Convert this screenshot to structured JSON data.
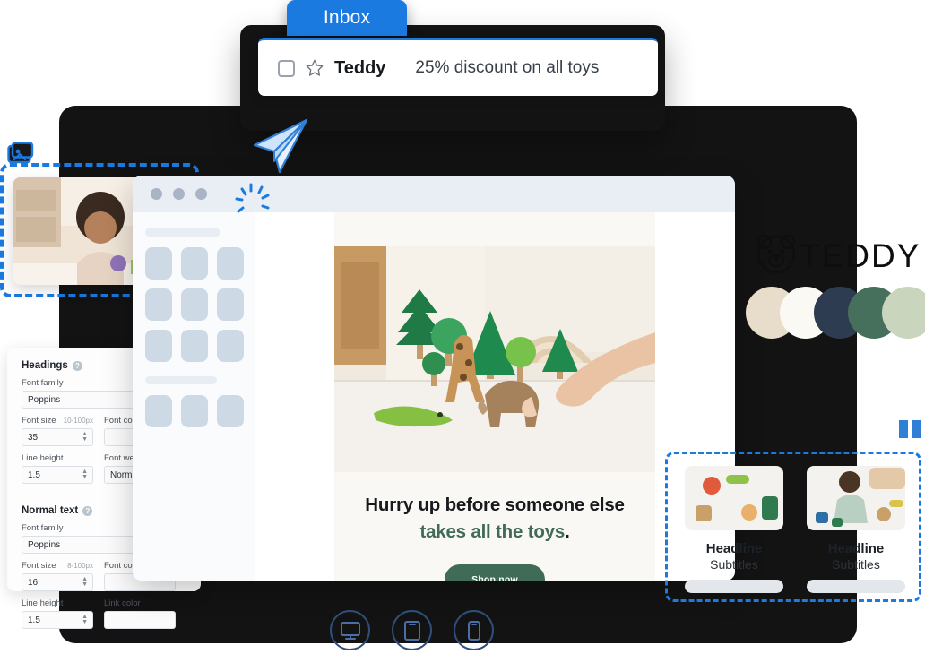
{
  "inbox": {
    "tab_label": "Inbox",
    "mail": {
      "sender": "Teddy",
      "subject": "25% discount on all toys",
      "checkbox_icon": "checkbox-icon",
      "star_icon": "star-icon"
    }
  },
  "send": {
    "plane_icon": "paper-plane-icon"
  },
  "photo_card": {
    "image_icon": "image-gallery-icon",
    "alt": "child playing with wooden toys"
  },
  "typography": {
    "sections": [
      {
        "title": "Headings",
        "help_icon": "help-icon",
        "font_family_label": "Font family",
        "font_family_value": "Poppins",
        "font_size_label": "Font size",
        "font_size_hint": "10-100px",
        "font_size_value": "35",
        "font_color_label": "Font color",
        "font_color_value": "",
        "line_height_label": "Line height",
        "line_height_value": "1.5",
        "extra_label": "Font weight",
        "extra_value": "Normal"
      },
      {
        "title": "Normal text",
        "help_icon": "help-icon",
        "font_family_label": "Font family",
        "font_family_value": "Poppins",
        "font_size_label": "Font size",
        "font_size_hint": "8-100px",
        "font_size_value": "16",
        "font_color_label": "Font color",
        "font_color_value": "",
        "line_height_label": "Line height",
        "line_height_value": "1.5",
        "extra_label": "Link color",
        "extra_value": ""
      }
    ]
  },
  "builder": {
    "window_dots": "window-controls",
    "loading_icon": "loading-spinner-icon",
    "email": {
      "hero_alt": "wooden animal and tree toys on a table",
      "headline_part1": "Hurry up before someone else ",
      "headline_accent": "takes all the toys",
      "headline_end": ".",
      "cta_label": "Shop now"
    }
  },
  "brand": {
    "logo_text": "TEDDY",
    "logo_icon": "teddy-bear-icon",
    "palette": [
      {
        "name": "beige",
        "hex": "#e8dccb"
      },
      {
        "name": "off-white",
        "hex": "#fbf9f4"
      },
      {
        "name": "navy",
        "hex": "#2e3c51"
      },
      {
        "name": "green",
        "hex": "#47705c"
      },
      {
        "name": "sage",
        "hex": "#c9d6bd"
      }
    ]
  },
  "cards": {
    "layout_icon": "two-column-layout-icon",
    "items": [
      {
        "headline": "Headline",
        "subtitle": "Subtitles",
        "image_alt": "toys on floor"
      },
      {
        "headline": "Headline",
        "subtitle": "Subtitles",
        "image_alt": "child sitting with toys"
      }
    ]
  },
  "device_toolbar": {
    "buttons": [
      {
        "name": "desktop-preview",
        "icon": "desktop-icon"
      },
      {
        "name": "tablet-preview",
        "icon": "tablet-icon"
      },
      {
        "name": "mobile-preview",
        "icon": "mobile-icon"
      }
    ]
  },
  "colors": {
    "accent_blue": "#1b7ae0",
    "brand_green": "#3f6b57",
    "device_dark": "#131314"
  }
}
